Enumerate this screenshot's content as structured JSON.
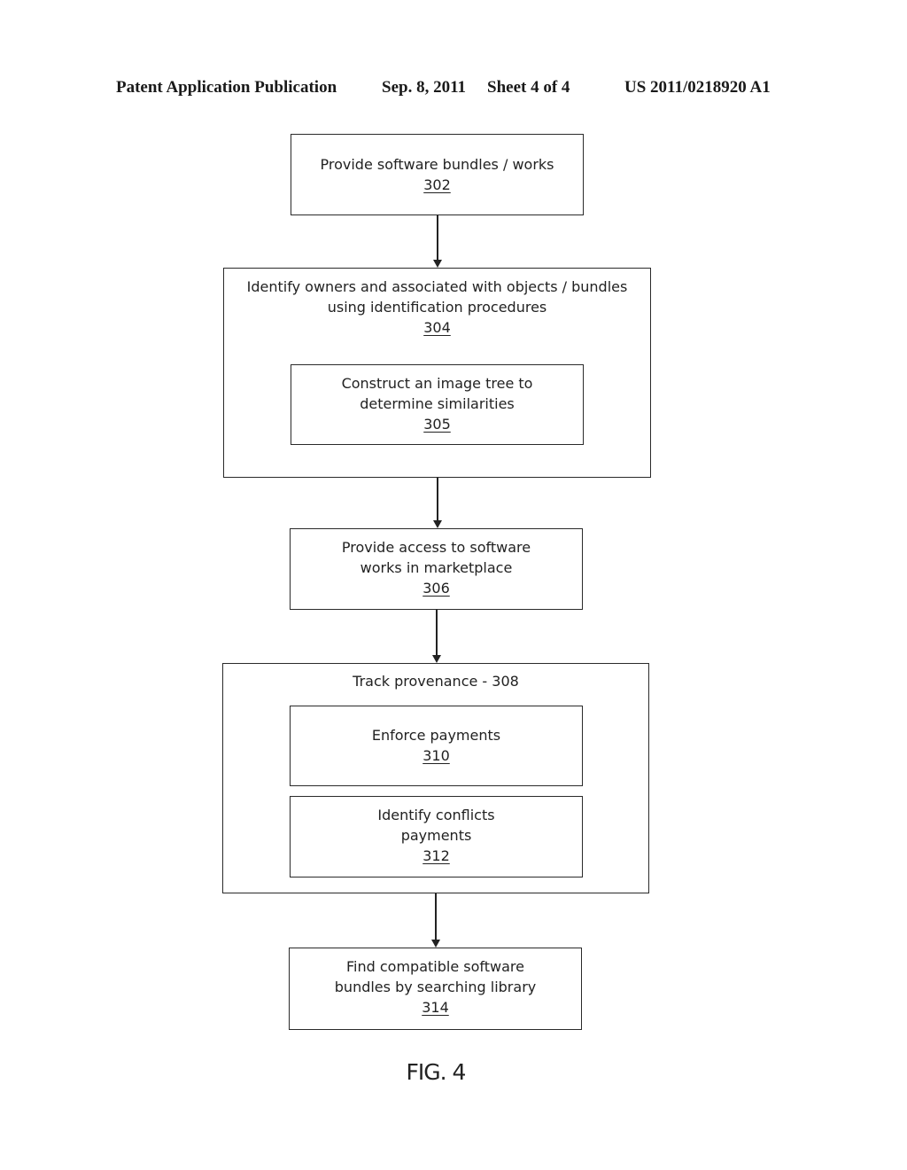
{
  "header": {
    "publication": "Patent Application Publication",
    "date": "Sep. 8, 2011",
    "sheet": "Sheet 4 of 4",
    "number": "US 2011/0218920 A1"
  },
  "steps": {
    "s302": {
      "lines": [
        "Provide software bundles / works"
      ],
      "ref": "302"
    },
    "s304": {
      "lines": [
        "Identify owners and associated with objects / bundles",
        "using identification procedures"
      ],
      "ref": "304"
    },
    "s305": {
      "lines": [
        "Construct an image tree to",
        "determine similarities"
      ],
      "ref": "305"
    },
    "s306": {
      "lines": [
        "Provide access to software",
        "works in marketplace"
      ],
      "ref": "306"
    },
    "s308": {
      "title": "Track provenance - 308"
    },
    "s310": {
      "lines": [
        "Enforce payments"
      ],
      "ref": "310"
    },
    "s312": {
      "lines": [
        "Identify conflicts",
        "payments"
      ],
      "ref": "312"
    },
    "s314": {
      "lines": [
        "Find compatible software",
        "bundles by searching library"
      ],
      "ref": "314"
    }
  },
  "figure_label": "FIG. 4"
}
